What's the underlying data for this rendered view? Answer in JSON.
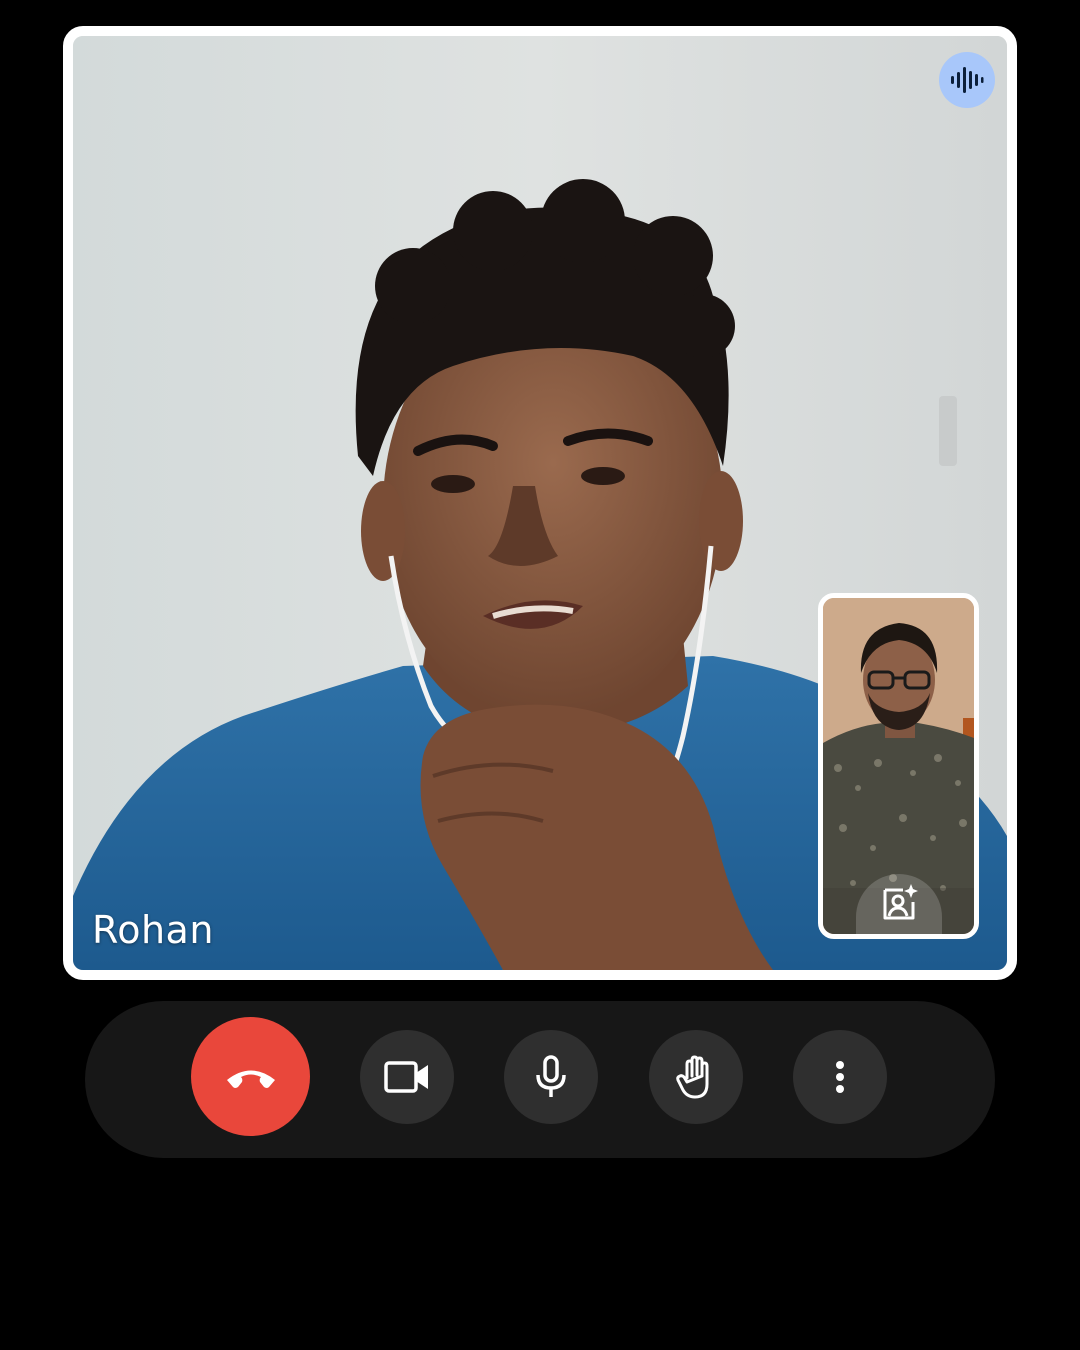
{
  "call": {
    "main_participant_name": "Rohan"
  },
  "icons": {
    "speaking_indicator": "audio-waveform-icon",
    "effects": "person-sparkle-icon",
    "end_call": "phone-hangup-icon",
    "camera": "videocam-icon",
    "microphone": "mic-icon",
    "raise_hand": "hand-icon",
    "more": "more-vert-icon"
  },
  "colors": {
    "end_call": "#e9473b",
    "control_button": "#2f2f2f",
    "control_bar": "#171717",
    "speaking_badge": "#a8c7fa",
    "tile_border": "#ffffff"
  }
}
